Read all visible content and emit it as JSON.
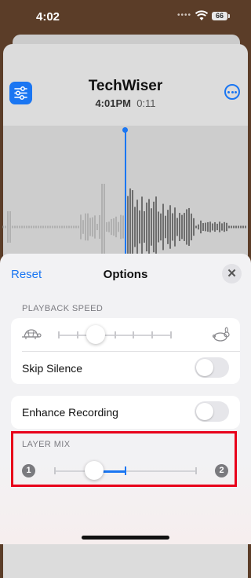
{
  "status_bar": {
    "time": "4:02",
    "battery": "66",
    "icons": [
      "signal-dots-icon",
      "wifi-icon",
      "battery-icon"
    ]
  },
  "recording": {
    "title": "TechWiser",
    "time": "4:01PM",
    "duration": "0:11"
  },
  "options": {
    "reset_label": "Reset",
    "title": "Options",
    "close_icon": "close-icon",
    "playback_speed": {
      "section_label": "PLAYBACK SPEED",
      "slow_icon": "turtle-icon",
      "fast_icon": "rabbit-icon",
      "level": 0.33
    },
    "skip_silence": {
      "label": "Skip Silence",
      "on": false
    },
    "enhance_recording": {
      "label": "Enhance Recording",
      "on": false
    },
    "layer_mix": {
      "section_label": "LAYER MIX",
      "left_badge": "1",
      "right_badge": "2",
      "level": 0.28
    }
  },
  "colors": {
    "accent": "#1a76f2",
    "highlight": "#e8001a"
  }
}
